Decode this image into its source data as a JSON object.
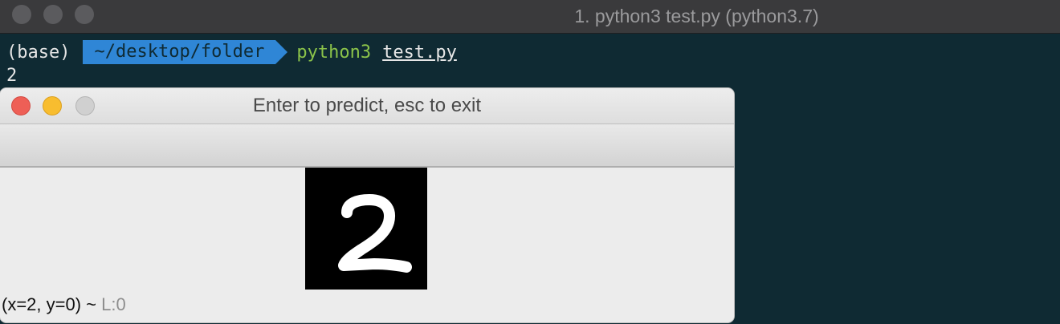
{
  "terminal": {
    "title": "1. python3 test.py (python3.7)",
    "prompt_env": "(base)",
    "prompt_path": "~/desktop/folder",
    "command": "python3",
    "argument": "test.py",
    "output_line": "2"
  },
  "popup": {
    "title": "Enter to predict, esc to exit",
    "image_icon": "digit-2-image",
    "status_coords": "(x=2, y=0) ~",
    "status_level": "L:0"
  },
  "colors": {
    "terminal_bg": "#0f2a33",
    "prompt_path_bg": "#2f86d6",
    "command_color": "#8bc34a",
    "close_dot": "#ee5f56",
    "minimize_dot": "#f8bd2f"
  }
}
